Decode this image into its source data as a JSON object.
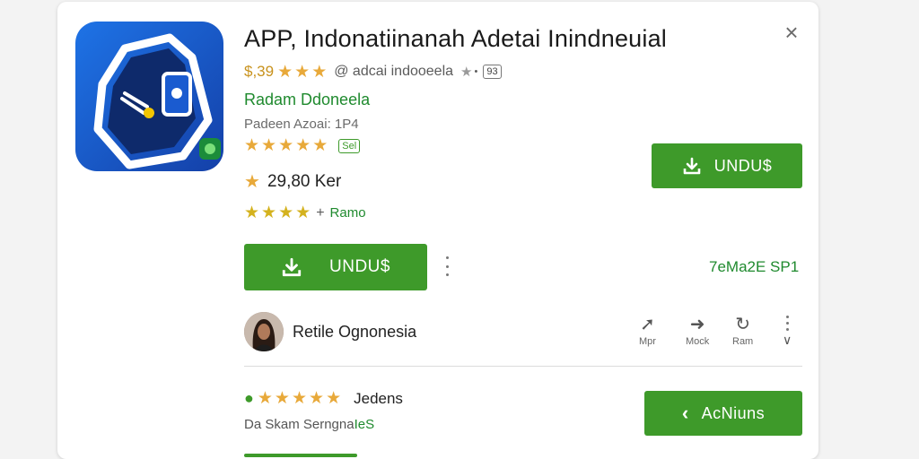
{
  "app": {
    "title": "APP, Indonatiinanah Adetai Inindneuial",
    "price": "$,39",
    "meta_text": "@ adcai indooeela",
    "meta_badge": "93",
    "developer": "Radam Ddoneela",
    "subinfo": "Padeen Azoai: 1P4",
    "rating_badge": "Sel",
    "reviews_count": "29,80 Ker",
    "rank_label": "Ramo"
  },
  "buttons": {
    "install_top": "UNDU$",
    "install_main": "UNDU$",
    "action": "AcNiuns"
  },
  "update_text": "7eMa2E SP1",
  "publisher": {
    "name": "Retile Ognonesia"
  },
  "actions": [
    {
      "label": "Mpr",
      "icon": "arrow-up-icon"
    },
    {
      "label": "Mock",
      "icon": "arrow-right-icon"
    },
    {
      "label": "Ram",
      "icon": "refresh-icon"
    }
  ],
  "review": {
    "label": "Jedens",
    "sub_prefix": "Da Skam Serngna",
    "sub_suffix": "IeS"
  },
  "colors": {
    "accent_green": "#3e9a2a",
    "star_gold": "#e8a93a",
    "icon_blue": "#1a5bd0"
  }
}
